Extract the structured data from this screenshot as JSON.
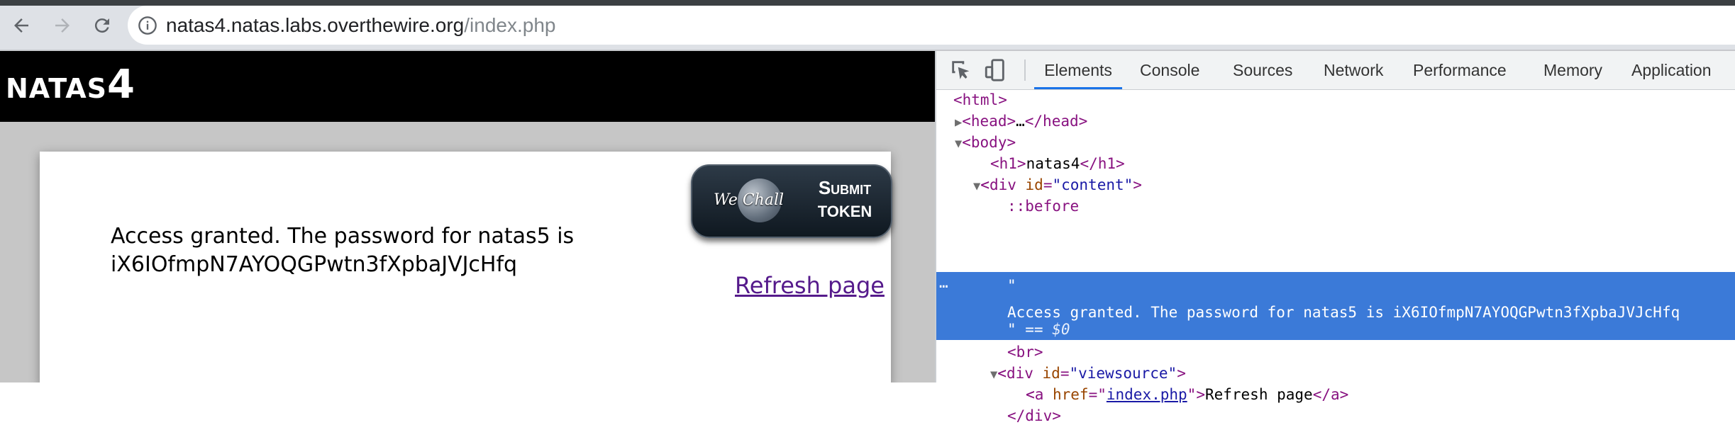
{
  "browser": {
    "back_icon": "arrow-left-icon",
    "forward_icon": "arrow-right-icon",
    "reload_icon": "reload-icon",
    "info_icon": "info-icon",
    "url_host": "natas4.natas.labs.overthewire.org",
    "url_path": "/index.php"
  },
  "page": {
    "title_prefix": "NATAS",
    "title_number": "4",
    "message_line1": "Access granted. The password for natas5 is",
    "message_line2": "iX6IOfmpN7AYOQGPwtn3fXpbaJVJcHfq",
    "wechall_text": "We Chall",
    "submit_line1": "Submit",
    "submit_line2": "token",
    "refresh_link": "Refresh page"
  },
  "devtools": {
    "tabs": [
      "Elements",
      "Console",
      "Sources",
      "Network",
      "Performance",
      "Memory",
      "Application"
    ],
    "active_tab": "Elements",
    "inspect_icon": "inspect-cursor-icon",
    "device_icon": "device-toolbar-icon",
    "dom": {
      "html_open": "<html>",
      "head_open": "<head>",
      "head_ellipsis": "…",
      "head_close": "</head>",
      "body_open": "<body>",
      "h1_open": "<h1>",
      "h1_text": "natas4",
      "h1_close": "</h1>",
      "div_content_tag": "<div ",
      "div_content_attr": "id",
      "div_content_val": "\"content\"",
      "before": "::before",
      "sel_quote_open": "\"",
      "sel_text": "Access granted. The password for natas5 is iX6IOfmpN7AYOQGPwtn3fXpbaJVJcHfq",
      "sel_quote_close": "\" == ",
      "sel_dollar": "$0",
      "ellipsis": "…",
      "br": "<br>",
      "div_view_tag": "<div ",
      "div_view_attr": "id",
      "div_view_val": "\"viewsource\"",
      "a_open": "<a ",
      "a_attr": "href",
      "a_val": "index.php",
      "a_text": "Refresh page",
      "a_close": "</a>",
      "div_close": "</div>"
    }
  }
}
